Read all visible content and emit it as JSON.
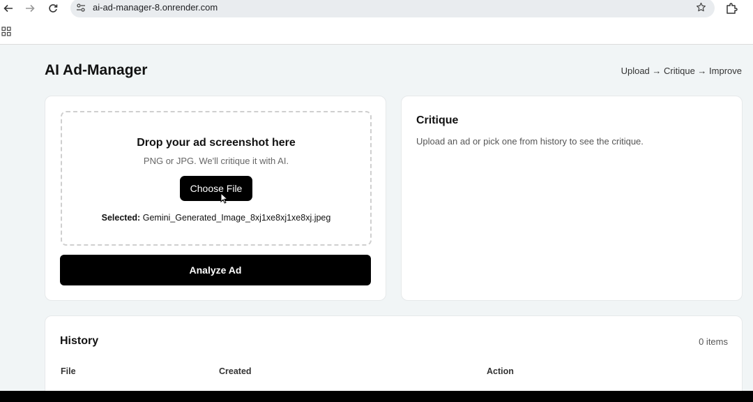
{
  "browser": {
    "url": "ai-ad-manager-8.onrender.com",
    "icons": [
      "back-icon",
      "forward-icon",
      "reload-icon",
      "site-info-icon",
      "star-icon",
      "extensions-icon",
      "apps-grid-icon"
    ]
  },
  "header": {
    "title": "AI Ad-Manager",
    "steps": "Upload → Critique → Improve"
  },
  "upload": {
    "dropzone_title": "Drop your ad screenshot here",
    "dropzone_subtitle": "PNG or JPG. We'll critique it with AI.",
    "choose_file_label": "Choose File",
    "selected_label": "Selected:",
    "selected_file": "Gemini_Generated_Image_8xj1xe8xj1xe8xj.jpeg",
    "analyze_label": "Analyze Ad"
  },
  "critique": {
    "title": "Critique",
    "hint": "Upload an ad or pick one from history to see the critique."
  },
  "history": {
    "title": "History",
    "count": "0 items",
    "columns": [
      "File",
      "Created",
      "Action"
    ]
  },
  "colors": {
    "page_bg": "#f1f5f6",
    "card_bg": "#ffffff",
    "button_bg": "#000000",
    "button_text": "#ffffff"
  }
}
